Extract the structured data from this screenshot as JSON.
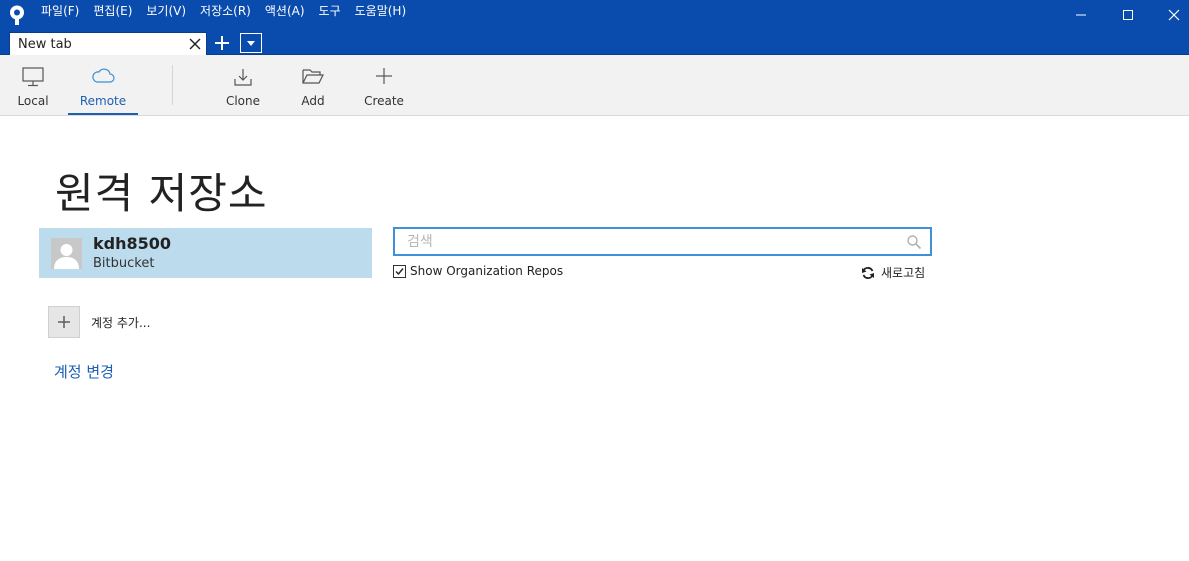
{
  "titlebar": {
    "menu": [
      "파일(F)",
      "편집(E)",
      "보기(V)",
      "저장소(R)",
      "액션(A)",
      "도구",
      "도움말(H)"
    ],
    "colors": {
      "background": "#0a4cad",
      "text": "#ffffff"
    }
  },
  "window_controls": [
    "minimize-icon",
    "maximize-icon",
    "close-icon"
  ],
  "tabs": {
    "items": [
      {
        "label": "New tab",
        "active": true
      }
    ],
    "add_icon": "plus-icon",
    "dropdown_icon": "chevron-down-icon"
  },
  "toolbar": {
    "local": {
      "label": "Local",
      "icon": "monitor-icon"
    },
    "remote": {
      "label": "Remote",
      "icon": "cloud-icon",
      "selected": true
    },
    "clone": {
      "label": "Clone",
      "icon": "download-icon"
    },
    "add": {
      "label": "Add",
      "icon": "folder-open-icon"
    },
    "create": {
      "label": "Create",
      "icon": "plus-icon"
    },
    "accent": "#1c5fb4"
  },
  "main": {
    "title": "원격 저장소",
    "account": {
      "name": "kdh8500",
      "host": "Bitbucket",
      "selected_bg": "#bcdcee"
    },
    "search": {
      "placeholder": "검색",
      "value": ""
    },
    "show_org_repos": {
      "label": "Show Organization Repos",
      "checked": true
    },
    "refresh_label": "새로고침",
    "add_account_label": "계정 추가...",
    "change_account_label": "계정 변경"
  }
}
